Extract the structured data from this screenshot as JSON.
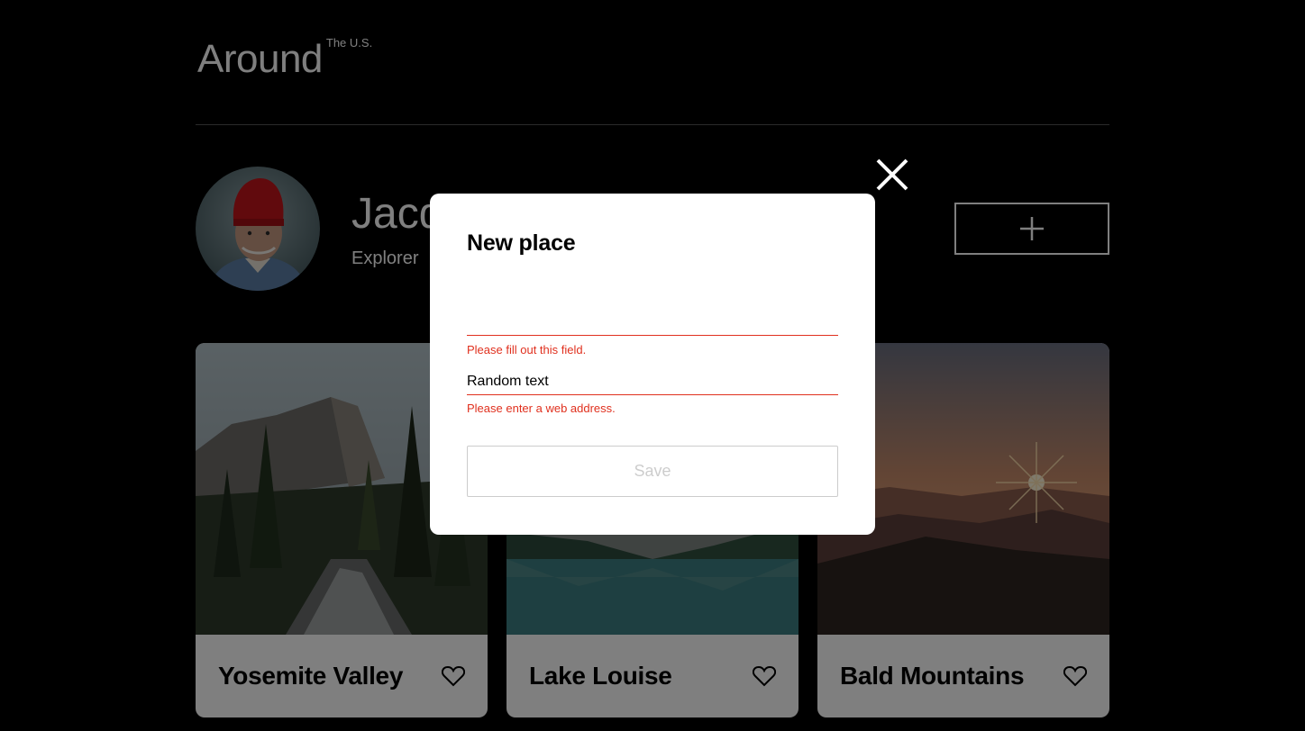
{
  "header": {
    "logo_main": "Around",
    "logo_sup": "The U.S."
  },
  "profile": {
    "name": "Jacques Cousteau",
    "job": "Explorer",
    "add_button_icon": "plus-icon"
  },
  "cards": [
    {
      "title": "Yosemite Valley",
      "like_icon": "heart-icon"
    },
    {
      "title": "Lake Louise",
      "like_icon": "heart-icon"
    },
    {
      "title": "Bald Mountains",
      "like_icon": "heart-icon"
    }
  ],
  "modal": {
    "title": "New place",
    "name_field": {
      "value": "",
      "error": "Please fill out this field."
    },
    "link_field": {
      "value": "Random text",
      "error": "Please enter a web address."
    },
    "save_label": "Save",
    "close_icon": "close-icon"
  },
  "colors": {
    "background": "#000000",
    "error": "#e0301e",
    "overlay": "rgba(0,0,0,0.5)"
  }
}
